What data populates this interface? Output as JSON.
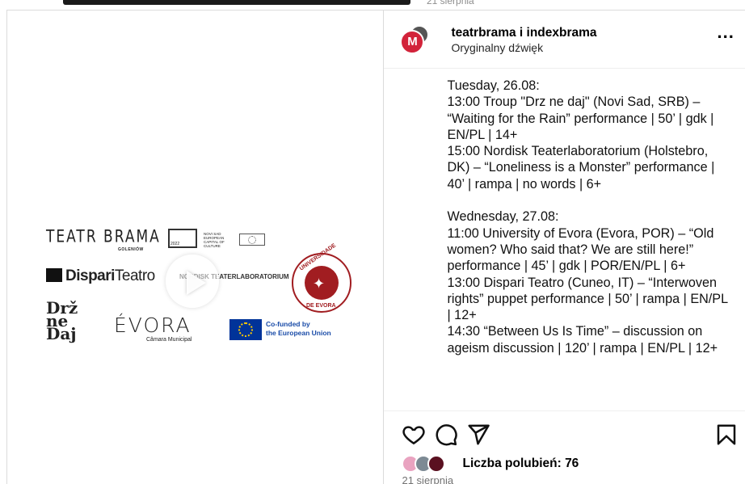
{
  "top_date": "21 sierpnia",
  "header": {
    "author": "teatrbrama i indexbrama",
    "audio": "Oryginalny dźwięk",
    "avatar_letter": "M",
    "more": "..."
  },
  "media": {
    "logos": {
      "teatr": "TEATR BRAMA",
      "teatr_sub": "GOLENIÓW",
      "novisad": "NOVI SAD EUROPEAN CAPITAL OF CULTURE",
      "novisad_year": "2022",
      "dispari_bold": "Dispari",
      "dispari_light": "Teatro",
      "nordisk": "NORDISK TEATERLABORATORIUM",
      "drz": "Drž ne Daj",
      "evora": "ÉVORA",
      "evora_sub": "Câmara Municipal",
      "eu_line1": "Co-funded by",
      "eu_line2": "the European Union",
      "universidade": "UNIVERSIDADE",
      "de_evora": "DE EVORA"
    }
  },
  "caption": "Tuesday, 26.08:\n13:00 Troup \"Drz ne daj\" (Novi Sad, SRB) – “Waiting for the Rain” performance | 50’ | gdk | EN/PL | 14+\n15:00 Nordisk Teaterlaboratorium (Holstebro, DK) – “Loneliness is a Monster” performance | 40’ | rampa | no words | 6+\n\nWednesday, 27.08:\n11:00 University of Evora (Evora, POR) – “Old women? Who said that? We are still here!” performance | 45’ | gdk | POR/EN/PL | 6+\n13:00 Dispari Teatro (Cuneo, IT) – “Interwoven rights” puppet performance | 50’ | rampa | EN/PL | 12+\n14:30 “Between Us Is Time” – discussion on ageism discussion | 120’ | rampa | EN/PL | 12+",
  "actions": {
    "like_icon": "heart-icon",
    "comment_icon": "comment-icon",
    "share_icon": "share-icon",
    "save_icon": "bookmark-icon"
  },
  "likes_text": "Liczba polubień: 76",
  "post_date": "21 sierpnia"
}
